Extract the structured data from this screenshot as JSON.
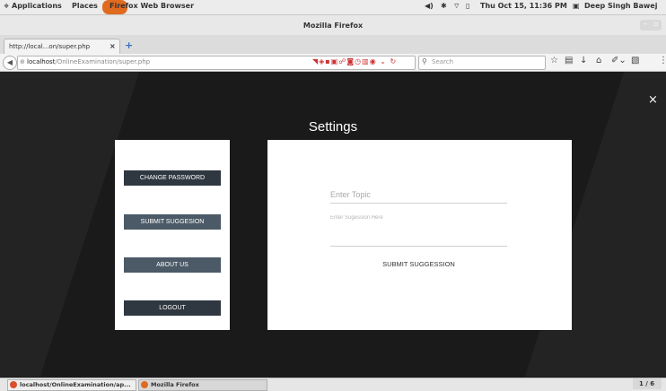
{
  "top_panel": {
    "applications": "Applications",
    "places": "Places",
    "active_app": "Firefox Web Browser",
    "clock": "Thu Oct 15, 11:36 PM",
    "user": "Deep Singh Bawej"
  },
  "window": {
    "title": "Mozilla Firefox"
  },
  "tab": {
    "label": "http://local...on/super.php",
    "close": "×",
    "new_tab": "+"
  },
  "navbar": {
    "url_host": "localhost",
    "url_path": "/OnlineExamination/super.php",
    "search_placeholder": "Search",
    "back": "◀"
  },
  "page": {
    "title": "Settings",
    "close": "×",
    "sidebar": {
      "buttons": [
        {
          "label": "CHANGE PASSWORD",
          "color": "#2f3740"
        },
        {
          "label": "SUBMIT SUGGESION",
          "color": "#4b5a66"
        },
        {
          "label": "ABOUT US",
          "color": "#4b5a66"
        },
        {
          "label": "LOGOUT",
          "color": "#2f3740"
        }
      ]
    },
    "form": {
      "topic_placeholder": "Enter Topic",
      "suggestion_placeholder": "Enter Sugession Here",
      "submit_label": "SUBMIT SUGGESSION"
    }
  },
  "taskbar": {
    "items": [
      {
        "label": "localhost/OnlineExamination/ap..."
      },
      {
        "label": "Mozilla Firefox"
      }
    ],
    "workspace": "1 / 6"
  }
}
